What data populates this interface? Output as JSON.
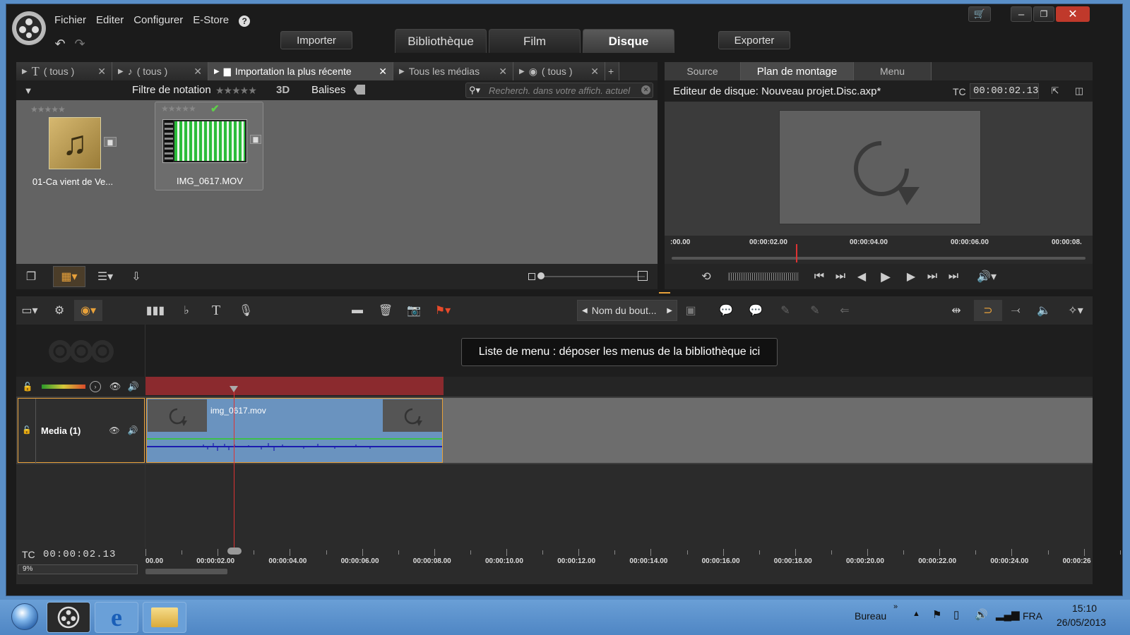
{
  "menu": {
    "items": [
      "Fichier",
      "Editer",
      "Configurer",
      "E-Store"
    ],
    "help": "?"
  },
  "toolbar": {
    "import_label": "Importer",
    "export_label": "Exporter"
  },
  "main_tabs": [
    {
      "label": "Bibliothèque",
      "active": false
    },
    {
      "label": "Film",
      "active": false
    },
    {
      "label": "Disque",
      "active": true
    }
  ],
  "library": {
    "tabs": [
      {
        "icon": "text-icon",
        "label": "( tous )"
      },
      {
        "icon": "note-icon",
        "label": "( tous )"
      },
      {
        "icon": "folder-icon",
        "label": "Importation la plus récente"
      },
      {
        "icon": "",
        "label": "Tous les médias"
      },
      {
        "icon": "disc-icon",
        "label": "( tous )"
      }
    ],
    "filter_label": "Filtre de notation",
    "three_d": "3D",
    "tags_label": "Balises",
    "search_placeholder": "Recherch. dans votre affich. actuel",
    "items": [
      {
        "name": "01-Ca vient de Ve...",
        "type": "audio"
      },
      {
        "name": "IMG_0617.MOV",
        "type": "video"
      }
    ]
  },
  "preview": {
    "tabs": [
      {
        "label": "Source",
        "active": false
      },
      {
        "label": "Plan de montage",
        "active": true
      },
      {
        "label": "Menu",
        "active": false
      }
    ],
    "title": "Editeur de disque: Nouveau projet.Disc.axp*",
    "tc_label": "TC",
    "tc_value": "00:00:02.13",
    "ruler": [
      ":00.00",
      "00:00:02.00",
      "00:00:04.00",
      "00:00:06.00",
      "00:00:08."
    ],
    "playhead_fraction": 0.3
  },
  "timeline": {
    "button_name": "Nom du bout...",
    "menu_list_message": "Liste de menu : déposer les menus de la bibliothèque ici",
    "track_name": "Media (1)",
    "clip_name": "img_0617.mov",
    "tc_label": "TC",
    "tc_value": "00:00:02.13",
    "zoom": "9%",
    "ruler": [
      "00.00",
      "00:00:02.00",
      "00:00:04.00",
      "00:00:06.00",
      "00:00:08.00",
      "00:00:10.00",
      "00:00:12.00",
      "00:00:14.00",
      "00:00:16.00",
      "00:00:18.00",
      "00:00:20.00",
      "00:00:22.00",
      "00:00:24.00",
      "00:00:26"
    ]
  },
  "taskbar": {
    "bureau": "Bureau",
    "lang": "FRA",
    "time": "15:10",
    "date": "26/05/2013"
  },
  "colors": {
    "accent": "#e8a13a",
    "timeline_bar": "#8b2a2e",
    "clip": "#6a93bf"
  }
}
